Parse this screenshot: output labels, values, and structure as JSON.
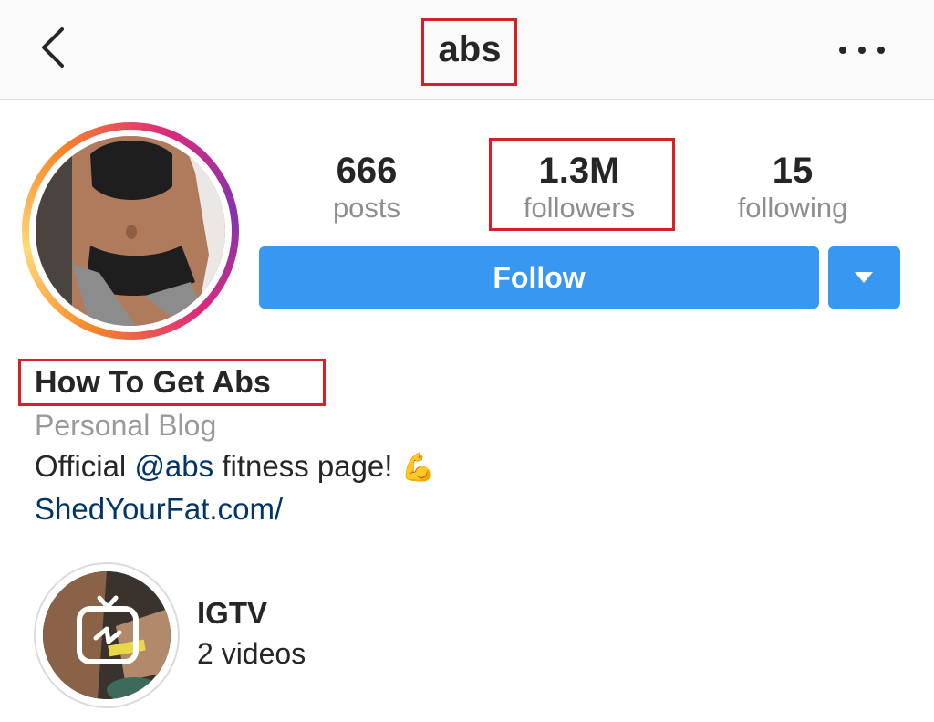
{
  "header": {
    "username": "abs",
    "back_icon": "chevron-left-icon",
    "more_icon": "ellipsis-icon"
  },
  "profile": {
    "avatar_icon": "profile-photo",
    "stats": [
      {
        "value": "666",
        "label": "posts"
      },
      {
        "value": "1.3M",
        "label": "followers"
      },
      {
        "value": "15",
        "label": "following"
      }
    ],
    "follow_label": "Follow",
    "dropdown_icon": "caret-down-icon"
  },
  "bio": {
    "full_name": "How To Get Abs",
    "category": "Personal Blog",
    "text_before": "Official ",
    "mention": "@abs",
    "text_after": " fitness page! ",
    "emoji": "💪",
    "website": "ShedYourFat.com/"
  },
  "highlight": {
    "title": "IGTV",
    "count": "2 videos",
    "icon": "igtv-icon"
  },
  "colors": {
    "accent": "#3897f0",
    "link": "#003569",
    "annotation": "#d62027"
  }
}
